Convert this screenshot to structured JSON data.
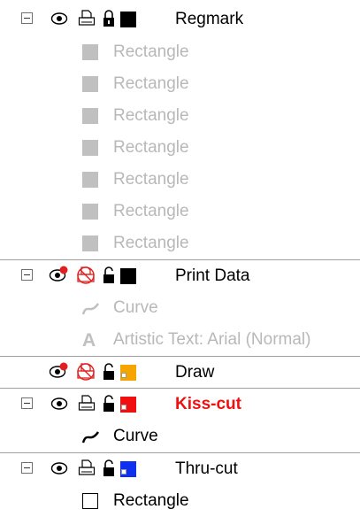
{
  "layers": [
    {
      "name": "Regmark",
      "color": "#000000",
      "label_color": "#000000",
      "label_bold": false,
      "visible": true,
      "printable": true,
      "locked": true,
      "children": [
        "Rectangle",
        "Rectangle",
        "Rectangle",
        "Rectangle",
        "Rectangle",
        "Rectangle",
        "Rectangle"
      ]
    },
    {
      "name": "Print Data",
      "color": "#000000",
      "visible": false,
      "printable": false,
      "locked": false,
      "children": [
        "Curve",
        "Artistic Text: Arial (Normal)"
      ]
    },
    {
      "name": "Draw",
      "color": "#f5a400",
      "visible": false,
      "printable": false,
      "locked": false,
      "children": []
    },
    {
      "name": "Kiss-cut",
      "color": "#f01010",
      "label_color": "#f01010",
      "visible": true,
      "printable": true,
      "locked": false,
      "children": [
        "Curve"
      ]
    },
    {
      "name": "Thru-cut",
      "color": "#1030f0",
      "visible": true,
      "printable": true,
      "locked": false,
      "children": [
        "Rectangle"
      ]
    }
  ],
  "icons": {
    "eye": "eye-icon",
    "eye_hidden": "eye-disabled-icon",
    "printer": "printer-icon",
    "printer_disabled": "printer-disabled-icon",
    "lock": "lock-icon",
    "unlock": "unlock-icon"
  },
  "colors": {
    "dim_text": "#b8b8b8",
    "separator": "#a0a0a0",
    "disabled_badge": "#e02020"
  }
}
